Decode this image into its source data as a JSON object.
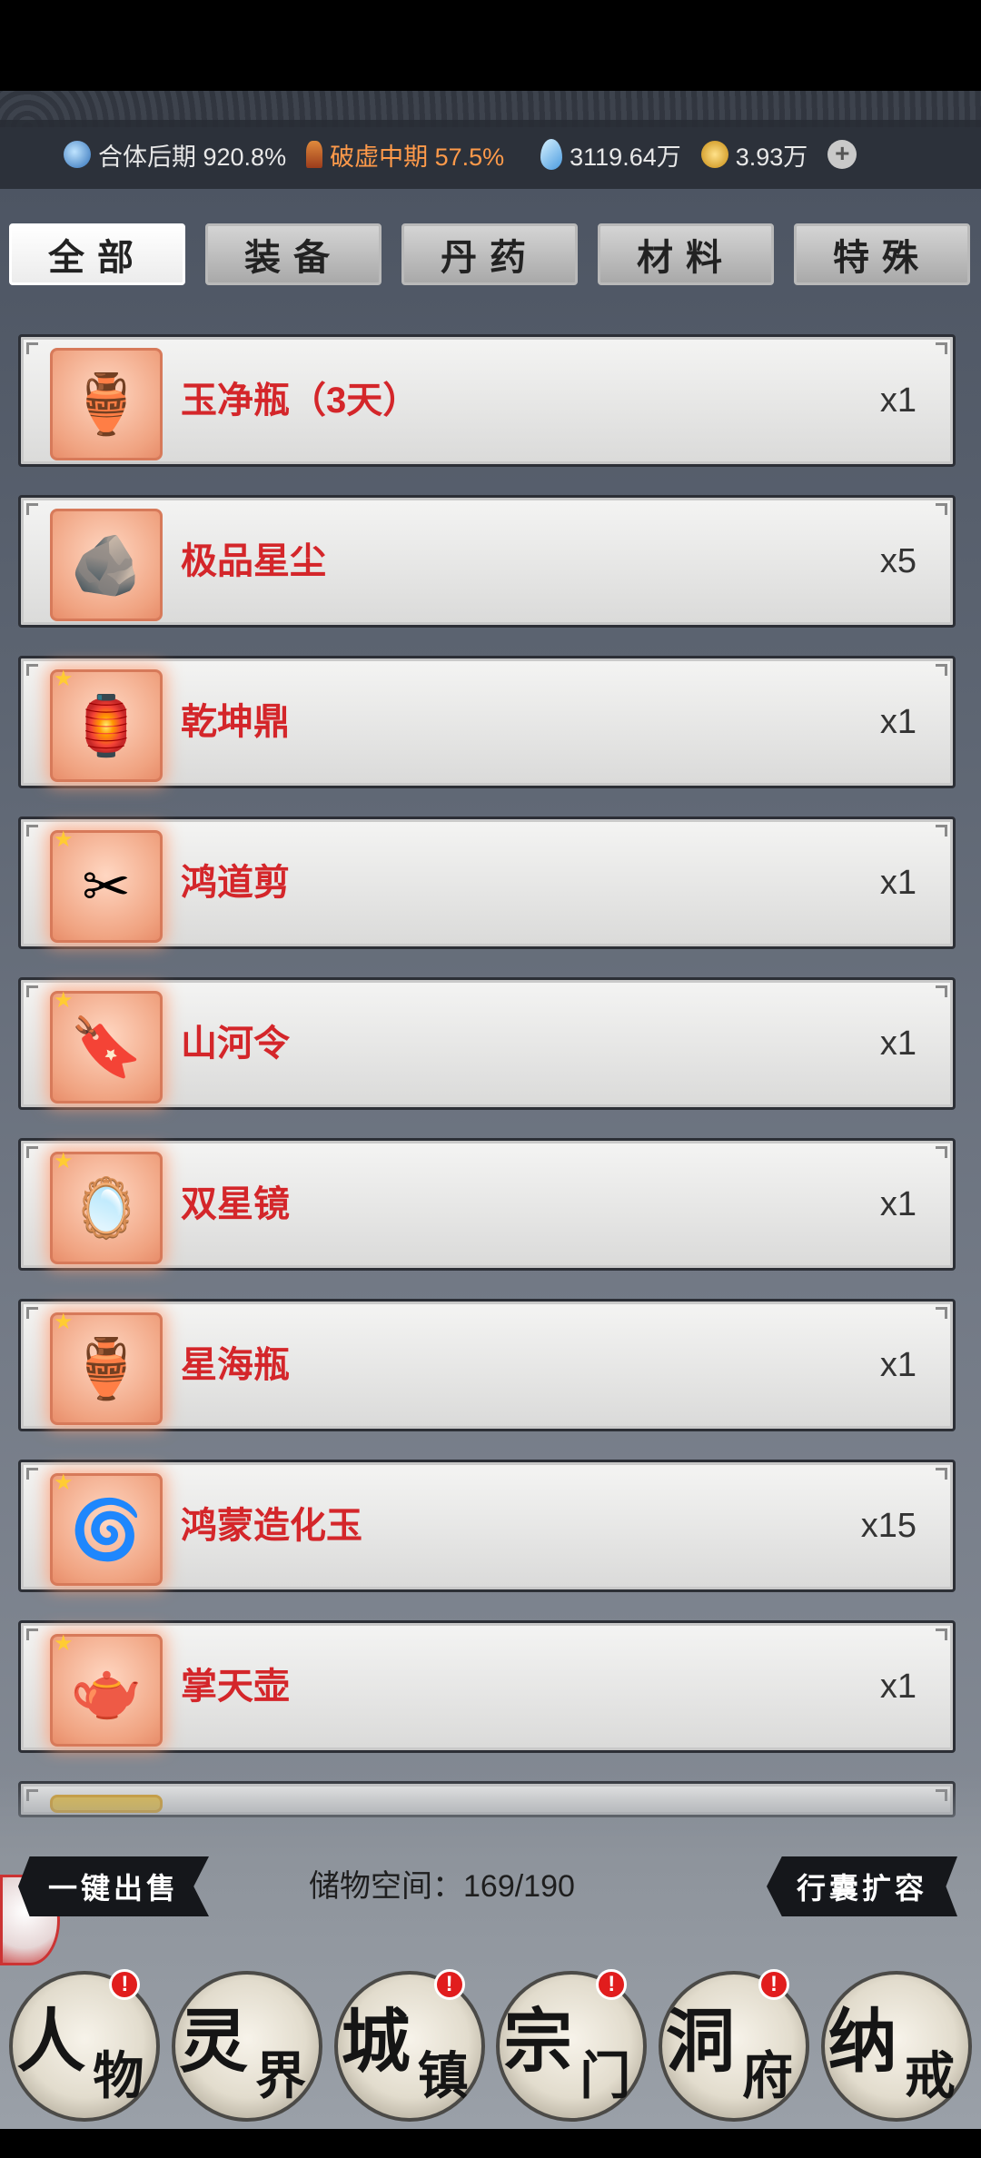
{
  "resources": {
    "realm_label": "合体后期 920.8%",
    "breakthrough_label": "破虚中期 57.5%",
    "spirit_stones": "3119.64万",
    "coins": "3.93万"
  },
  "tabs": [
    "全部",
    "装备",
    "丹药",
    "材料",
    "特殊"
  ],
  "items": [
    {
      "name": "玉净瓶（3天）",
      "qty": "x1",
      "icon": "🏺"
    },
    {
      "name": "极品星尘",
      "qty": "x5",
      "icon": "🪨"
    },
    {
      "name": "乾坤鼎",
      "qty": "x1",
      "icon": "🏮"
    },
    {
      "name": "鸿道剪",
      "qty": "x1",
      "icon": "✂"
    },
    {
      "name": "山河令",
      "qty": "x1",
      "icon": "🔖"
    },
    {
      "name": "双星镜",
      "qty": "x1",
      "icon": "🪞"
    },
    {
      "name": "星海瓶",
      "qty": "x1",
      "icon": "🏺"
    },
    {
      "name": "鸿蒙造化玉",
      "qty": "x15",
      "icon": "🌀"
    },
    {
      "name": "掌天壶",
      "qty": "x1",
      "icon": "🫖"
    }
  ],
  "actions": {
    "sell_all": "一键出售",
    "storage_text": "储物空间：169/190",
    "expand": "行囊扩容"
  },
  "nav": [
    {
      "c1": "人",
      "c2": "物",
      "badge": "!"
    },
    {
      "c1": "灵",
      "c2": "界",
      "badge": ""
    },
    {
      "c1": "城",
      "c2": "镇",
      "badge": "!"
    },
    {
      "c1": "宗",
      "c2": "门",
      "badge": "!"
    },
    {
      "c1": "洞",
      "c2": "府",
      "badge": "!"
    },
    {
      "c1": "纳",
      "c2": "戒",
      "badge": ""
    }
  ]
}
